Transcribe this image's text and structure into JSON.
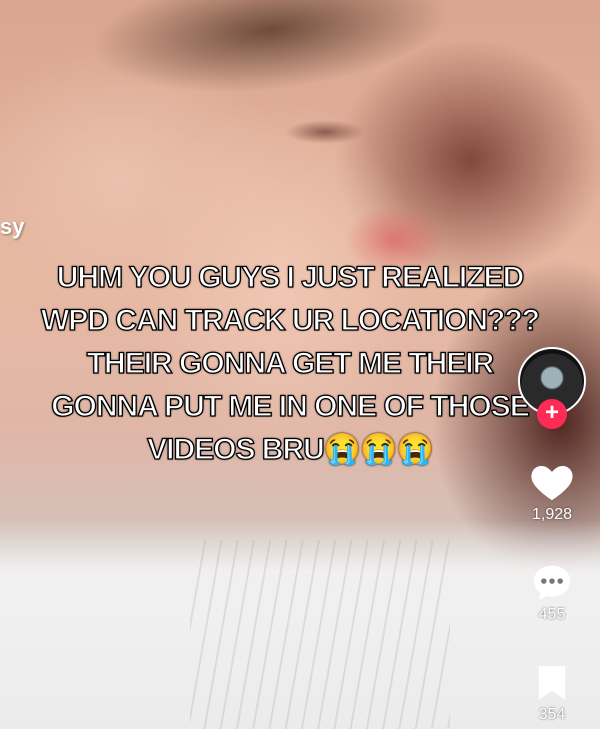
{
  "video": {
    "edge_text": "sy",
    "caption": "UHM YOU GUYS I JUST REALIZED WPD CAN TRACK UR LOCATION??? THEIR GONNA GET ME THEIR GONNA PUT ME IN ONE OF THOSE VIDEOS BRU😭😭😭"
  },
  "actions": {
    "follow_icon": "plus-icon",
    "follow_symbol": "+",
    "likes": "1,928",
    "comments": "455",
    "saves": "354"
  },
  "colors": {
    "follow_badge": "#fe2c55",
    "icon": "#ffffff"
  }
}
